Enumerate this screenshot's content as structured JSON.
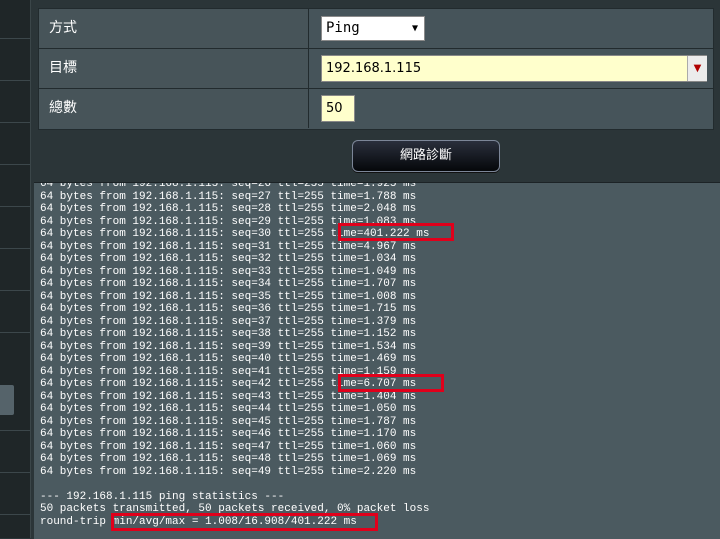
{
  "form": {
    "method": {
      "label": "方式",
      "value": "Ping"
    },
    "target": {
      "label": "目標",
      "value": "192.168.1.115"
    },
    "count": {
      "label": "總數",
      "value": "50"
    }
  },
  "diag_button": "網路診斷",
  "console_lines": [
    "64 bytes from 192.168.1.115: seq=26 ttl=255 time=1.925 ms",
    "64 bytes from 192.168.1.115: seq=27 ttl=255 time=1.788 ms",
    "64 bytes from 192.168.1.115: seq=28 ttl=255 time=2.048 ms",
    "64 bytes from 192.168.1.115: seq=29 ttl=255 time=1.083 ms",
    "64 bytes from 192.168.1.115: seq=30 ttl=255 time=401.222 ms",
    "64 bytes from 192.168.1.115: seq=31 ttl=255 time=4.967 ms",
    "64 bytes from 192.168.1.115: seq=32 ttl=255 time=1.034 ms",
    "64 bytes from 192.168.1.115: seq=33 ttl=255 time=1.049 ms",
    "64 bytes from 192.168.1.115: seq=34 ttl=255 time=1.707 ms",
    "64 bytes from 192.168.1.115: seq=35 ttl=255 time=1.008 ms",
    "64 bytes from 192.168.1.115: seq=36 ttl=255 time=1.715 ms",
    "64 bytes from 192.168.1.115: seq=37 ttl=255 time=1.379 ms",
    "64 bytes from 192.168.1.115: seq=38 ttl=255 time=1.152 ms",
    "64 bytes from 192.168.1.115: seq=39 ttl=255 time=1.534 ms",
    "64 bytes from 192.168.1.115: seq=40 ttl=255 time=1.469 ms",
    "64 bytes from 192.168.1.115: seq=41 ttl=255 time=1.159 ms",
    "64 bytes from 192.168.1.115: seq=42 ttl=255 time=6.707 ms",
    "64 bytes from 192.168.1.115: seq=43 ttl=255 time=1.404 ms",
    "64 bytes from 192.168.1.115: seq=44 ttl=255 time=1.050 ms",
    "64 bytes from 192.168.1.115: seq=45 ttl=255 time=1.787 ms",
    "64 bytes from 192.168.1.115: seq=46 ttl=255 time=1.170 ms",
    "64 bytes from 192.168.1.115: seq=47 ttl=255 time=1.060 ms",
    "64 bytes from 192.168.1.115: seq=48 ttl=255 time=1.069 ms",
    "64 bytes from 192.168.1.115: seq=49 ttl=255 time=2.220 ms",
    "",
    "--- 192.168.1.115 ping statistics ---",
    "50 packets transmitted, 50 packets received, 0% packet loss",
    "round-trip min/avg/max = 1.008/16.908/401.222 ms"
  ],
  "highlight_color": "#e0001b"
}
